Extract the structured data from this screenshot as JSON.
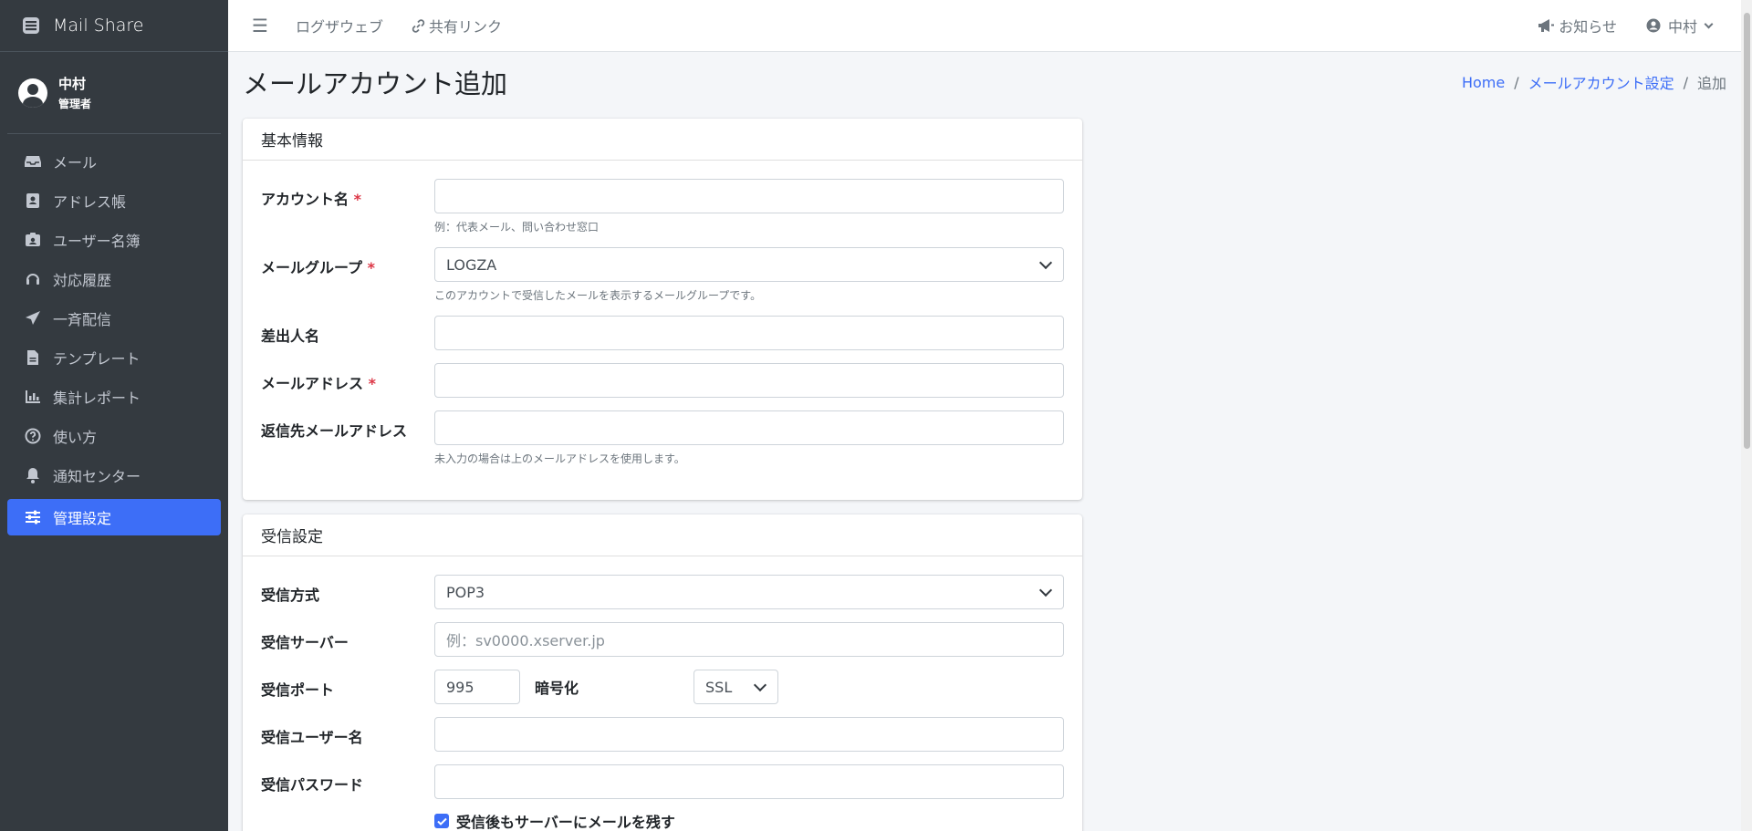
{
  "app": {
    "title": "Mail Share"
  },
  "user": {
    "name": "中村",
    "role": "管理者"
  },
  "sidebar": {
    "items": [
      {
        "label": "メール",
        "icon": "inbox-icon"
      },
      {
        "label": "アドレス帳",
        "icon": "address-book-icon"
      },
      {
        "label": "ユーザー名簿",
        "icon": "id-badge-icon"
      },
      {
        "label": "対応履歴",
        "icon": "headset-icon"
      },
      {
        "label": "一斉配信",
        "icon": "paper-plane-icon"
      },
      {
        "label": "テンプレート",
        "icon": "file-icon"
      },
      {
        "label": "集計レポート",
        "icon": "bar-chart-icon"
      },
      {
        "label": "使い方",
        "icon": "question-circle-icon"
      },
      {
        "label": "通知センター",
        "icon": "bell-icon"
      },
      {
        "label": "管理設定",
        "icon": "sliders-icon",
        "active": true
      }
    ]
  },
  "topbar": {
    "links": [
      "ログザウェブ",
      "共有リンク"
    ],
    "notifications_label": "お知らせ",
    "user_label": "中村"
  },
  "page": {
    "title": "メールアカウント追加",
    "breadcrumb": [
      "Home",
      "メールアカウント設定",
      "追加"
    ]
  },
  "basic": {
    "header": "基本情報",
    "account_name": {
      "label": "アカウント名",
      "required": "*",
      "value": "",
      "help": "例：代表メール、問い合わせ窓口"
    },
    "mail_group": {
      "label": "メールグループ",
      "required": "*",
      "value": "LOGZA",
      "help": "このアカウントで受信したメールを表示するメールグループです。"
    },
    "sender_name": {
      "label": "差出人名",
      "value": ""
    },
    "email": {
      "label": "メールアドレス",
      "required": "*",
      "value": ""
    },
    "reply_to": {
      "label": "返信先メールアドレス",
      "value": "",
      "help": "未入力の場合は上のメールアドレスを使用します。"
    }
  },
  "receive": {
    "header": "受信設定",
    "method": {
      "label": "受信方式",
      "value": "POP3"
    },
    "server": {
      "label": "受信サーバー",
      "placeholder": "例：sv0000.xserver.jp"
    },
    "port": {
      "label": "受信ポート",
      "value": "995"
    },
    "encryption": {
      "label": "暗号化",
      "value": "SSL"
    },
    "username": {
      "label": "受信ユーザー名",
      "value": ""
    },
    "password": {
      "label": "受信パスワード",
      "value": ""
    },
    "leave_on_server": {
      "label": "受信後もサーバーにメールを残す",
      "checked": true
    }
  },
  "colors": {
    "sidebar_bg": "#343a40",
    "accent": "#3d6ef7",
    "required": "#dc3545",
    "content_bg": "#f4f6f9"
  }
}
